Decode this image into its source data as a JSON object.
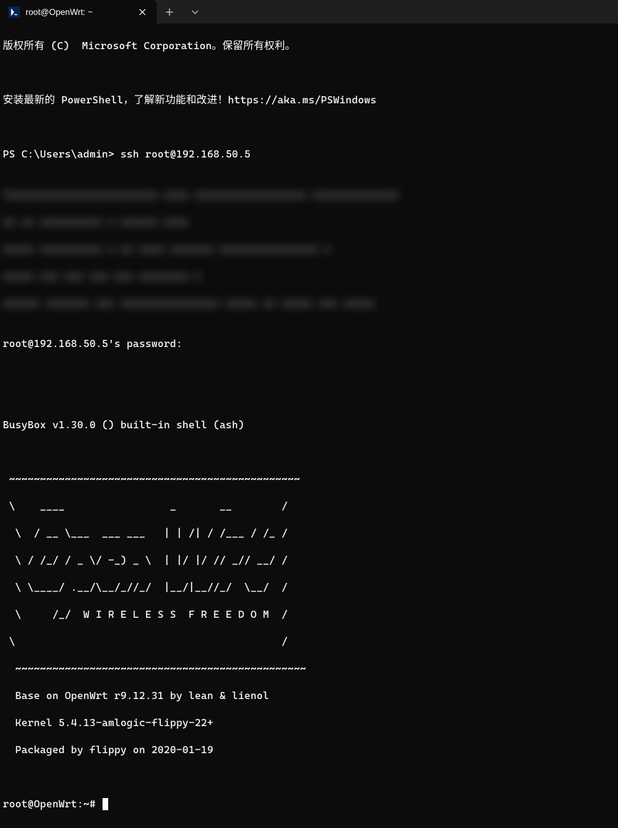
{
  "titlebar": {
    "tab_title": "root@OpenWrt: ~",
    "tab_icon_name": "powershell-icon"
  },
  "terminal": {
    "line1": "版权所有 (C)  Microsoft Corporation。保留所有权利。",
    "line2": "",
    "line3": "安装最新的 PowerShell，了解新功能和改进！https://aka.ms/PSWindows",
    "line4": "",
    "prompt_prefix": "PS C:\\Users\\admin> ",
    "ssh_command": "ssh root@192.168.50.5",
    "blurred1": "Txxxxxxxxxxxxxxxxxxxxxxxx xxxx xxxxxxxxxxxxxxxxxx xxxxxxxxxxxxxx",
    "blurred2": "xx xx xxxxxxxxxx x xxxxxx xxxx",
    "blurred3": "xxxxx xxxxxxxxxx x xx xxxx xxxxxxx xxxxxxxxxxxxxxxx x",
    "blurred4": "xxxxx xxx xxx xxx xxx xxxxxxxx x",
    "blurred5": "xxxxxx xxxxxxx xxx xxxxxxxxxxxxxxxx xxxxx xx xxxxx xxx xxxxx",
    "password_prompt": "root@192.168.50.5's password:",
    "busybox": "BusyBox v1.30.0 () built-in shell (ash)",
    "ascii1": " _______________________________________ ",
    "ascii2": " \\        ____                 _       __       __        /",
    "ascii3": "  \\      / __ \\____  ___  ____| |     / /____  / /_       /",
    "ascii4": "   \\    / / / / __ \\/ _ \\/ __ \\ | /| / / ___\\/ __/      /",
    "ascii5": "    \\  / /_/ / /_/ /  __/ / / / |/ |/ / /   / /_        /",
    "ascii6": "     \\ \\____/ .___/\\___/_/ /_/|__/|__/_/    \\__/       /",
    "ascii7": "      \\    /_/  W I R E L E S S   F R E E D O M       /",
    "ascii8": " \\                                                            /",
    "ascii9": "  ----------------------------------------------------------- ",
    "info1": "  Base on OpenWrt r9.12.31 by lean & lienol",
    "info2": "  Kernel 5.4.13-amlogic-flippy-22+",
    "info3": "  Packaged by flippy on 2020-01-19",
    "final_prompt": "root@OpenWrt:~# "
  }
}
